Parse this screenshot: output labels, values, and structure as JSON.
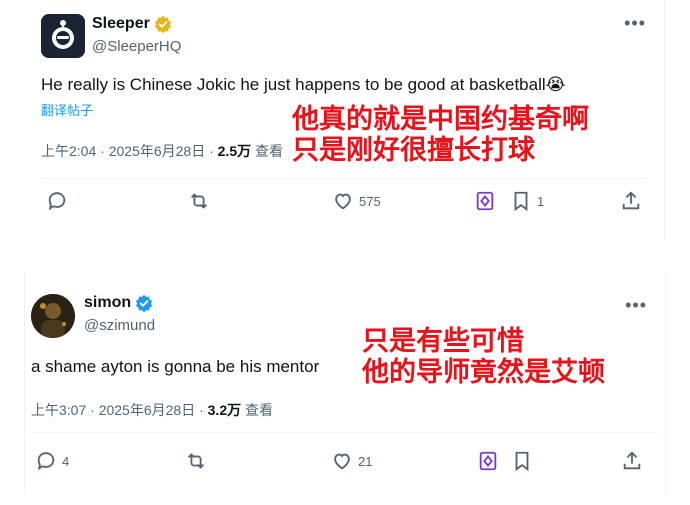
{
  "tweets": [
    {
      "display_name": "Sleeper",
      "handle": "@SleeperHQ",
      "verified_badge": "gold",
      "text": "He really is Chinese Jokic he just happens to be good at basketball",
      "emoji": "😭",
      "translate_link": "翻译帖子",
      "time": "上午2:04 · 2025年6月28日 · ",
      "views_count": "2.5万",
      "views_label": " 查看",
      "replies": "",
      "retweets": "",
      "likes": "575",
      "bookmarks": "1"
    },
    {
      "display_name": "simon",
      "handle": "@szimund",
      "verified_badge": "blue",
      "text": "a shame ayton is gonna be his mentor",
      "time": "上午3:07 · 2025年6月28日 · ",
      "views_count": "3.2万",
      "views_label": " 查看",
      "replies": "4",
      "retweets": "",
      "likes": "21",
      "bookmarks": ""
    }
  ],
  "annotations": {
    "first_line1": "他真的就是中国约基奇啊",
    "first_line2": "只是刚好很擅长打球",
    "second_line1": "只是有些可惜",
    "second_line2": "他的导师竟然是艾顿"
  },
  "watermark": "",
  "colors": {
    "annotation": "#e8121b",
    "link": "#1d9bf0",
    "secondary_text": "#536471",
    "gold_badge": "#e2b719",
    "blue_badge": "#1d9bf0",
    "grok": "#7a3bcc"
  },
  "icons": [
    "more-icon",
    "reply-icon",
    "retweet-icon",
    "like-icon",
    "grok-icon",
    "bookmark-icon",
    "share-icon"
  ]
}
